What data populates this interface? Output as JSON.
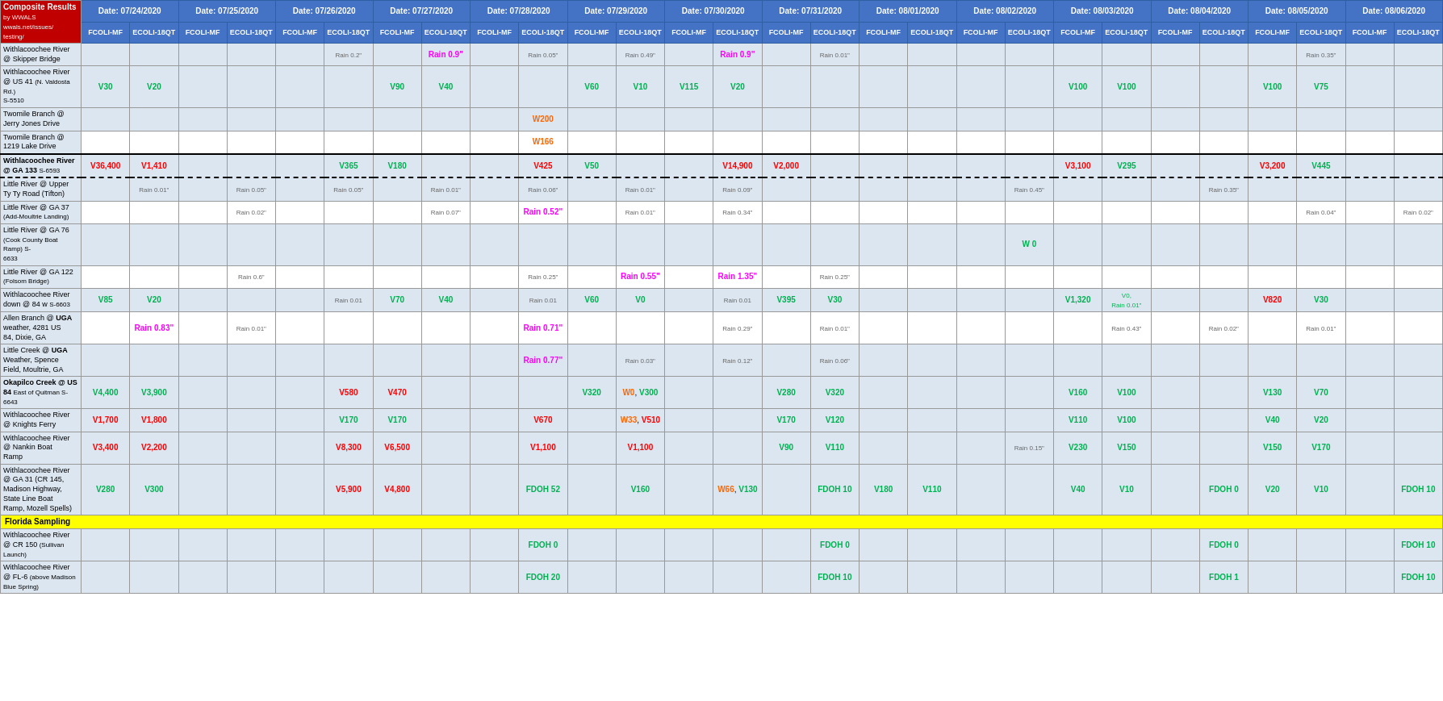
{
  "title": "Composite Results",
  "subtitle": "by WWALS\nwwals.net/issues/\ntesting/",
  "dates": [
    "07/24/2020",
    "07/25/2020",
    "07/26/2020",
    "07/27/2020",
    "07/28/2020",
    "07/29/2020",
    "07/30/2020",
    "07/31/2020",
    "08/01/2020",
    "08/02/2020",
    "08/03/2020",
    "08/04/2020",
    "08/05/2020",
    "08/06/2020"
  ],
  "col_headers": [
    "FCOLI-MF",
    "ECOLI-18QT"
  ],
  "rows": [
    {
      "location": "Withlacoochee River\n@ Skipper Bridge",
      "highlight": false,
      "cells": [
        "",
        "",
        "",
        "",
        "",
        "Rain 0.2\"",
        "",
        "Rain 0.9\"*",
        "",
        "Rain 0.05\"",
        "",
        "Rain 0.49\"",
        "",
        "Rain 0.9\"*",
        "",
        "Rain 0.01\"",
        "",
        "",
        "",
        "",
        "",
        "",
        "",
        "",
        "",
        "",
        "",
        "Rain 0.35\"",
        "",
        ""
      ]
    }
  ],
  "florida_label": "Florida Sampling",
  "colors": {
    "green": "#00b050",
    "red": "#ff0000",
    "magenta": "#ff00ff",
    "blue": "#0070c0",
    "header_blue": "#4472c4",
    "yellow": "#ffff00",
    "light_blue_bg": "#dce6f1"
  }
}
